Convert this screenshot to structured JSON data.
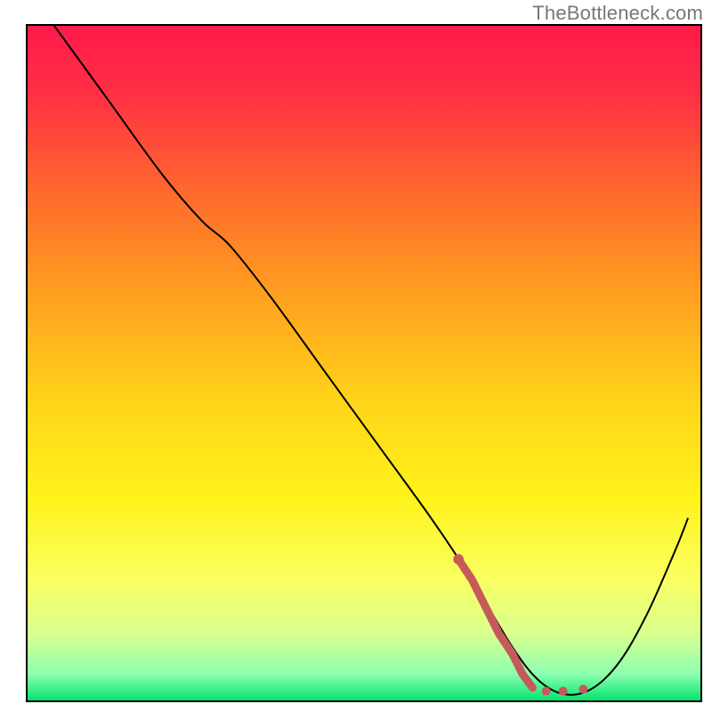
{
  "watermark": "TheBottleneck.com",
  "chart_data": {
    "type": "line",
    "title": "",
    "xlabel": "",
    "ylabel": "",
    "xlim": [
      0,
      100
    ],
    "ylim": [
      0,
      100
    ],
    "grid": false,
    "legend": false,
    "gradient_stops": [
      {
        "offset": 0.0,
        "color": "#ff1a4b"
      },
      {
        "offset": 0.1,
        "color": "#ff2f44"
      },
      {
        "offset": 0.25,
        "color": "#ff6a2c"
      },
      {
        "offset": 0.4,
        "color": "#ffa01f"
      },
      {
        "offset": 0.55,
        "color": "#ffd21a"
      },
      {
        "offset": 0.7,
        "color": "#fff31a"
      },
      {
        "offset": 0.82,
        "color": "#faff62"
      },
      {
        "offset": 0.9,
        "color": "#d8ff8e"
      },
      {
        "offset": 0.96,
        "color": "#8cffb0"
      },
      {
        "offset": 1.0,
        "color": "#00e26a"
      }
    ],
    "series": [
      {
        "name": "curve",
        "stroke": "#000000",
        "stroke_width": 2,
        "points": [
          {
            "x": 4,
            "y": 100
          },
          {
            "x": 12,
            "y": 89
          },
          {
            "x": 20,
            "y": 78
          },
          {
            "x": 26,
            "y": 71
          },
          {
            "x": 30,
            "y": 67.5
          },
          {
            "x": 36,
            "y": 60
          },
          {
            "x": 44,
            "y": 49
          },
          {
            "x": 52,
            "y": 38
          },
          {
            "x": 60,
            "y": 27
          },
          {
            "x": 66,
            "y": 18
          },
          {
            "x": 72,
            "y": 8
          },
          {
            "x": 76,
            "y": 3
          },
          {
            "x": 80,
            "y": 1
          },
          {
            "x": 84,
            "y": 2
          },
          {
            "x": 88,
            "y": 6
          },
          {
            "x": 92,
            "y": 13
          },
          {
            "x": 96,
            "y": 22
          },
          {
            "x": 98,
            "y": 27
          }
        ]
      },
      {
        "name": "highlight-dots",
        "stroke": "#c65a5a",
        "type_override": "scatter-line",
        "stroke_width": 9,
        "points": [
          {
            "x": 64,
            "y": 21
          },
          {
            "x": 66,
            "y": 18
          },
          {
            "x": 68,
            "y": 14
          },
          {
            "x": 70,
            "y": 10
          },
          {
            "x": 72,
            "y": 7
          },
          {
            "x": 73.5,
            "y": 4
          },
          {
            "x": 75,
            "y": 2
          },
          {
            "x": 77,
            "y": 1.5
          },
          {
            "x": 79.5,
            "y": 1.5
          },
          {
            "x": 82.5,
            "y": 1.8
          }
        ]
      }
    ]
  }
}
